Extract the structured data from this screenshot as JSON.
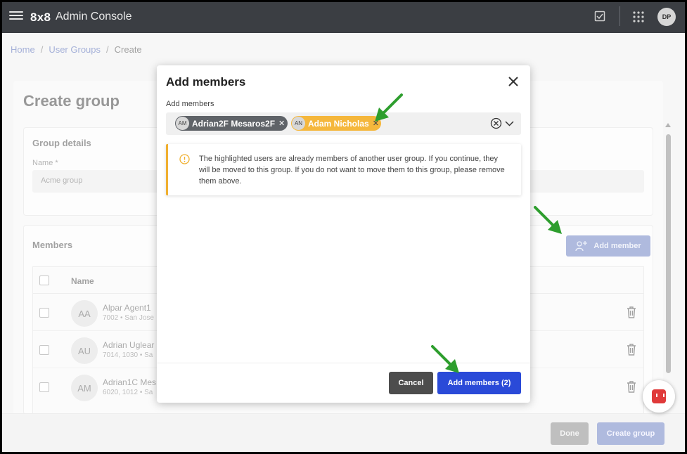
{
  "topbar": {
    "logo": "8x8",
    "title": "Admin Console",
    "user_initials": "DP",
    "icons": [
      "hamburger-menu-icon",
      "checklist-icon",
      "app-grid-icon"
    ]
  },
  "breadcrumb": {
    "home": "Home",
    "user_groups": "User Groups",
    "current": "Create",
    "separator": "/"
  },
  "page": {
    "title": "Create group",
    "details": {
      "title": "Group details",
      "name_label": "Name *",
      "name_value": "Acme group"
    },
    "members": {
      "title": "Members",
      "add_member_label": "Add member",
      "column_name": "Name",
      "rows": [
        {
          "initials": "AA",
          "name": "Alpar Agent1",
          "sub": "7002 • San Jose"
        },
        {
          "initials": "AU",
          "name": "Adrian Uglear",
          "sub": "7014, 1030 • Sa"
        },
        {
          "initials": "AM",
          "name": "Adrian1C Mes",
          "sub": "6020, 1012 • Sa"
        }
      ]
    },
    "footer": {
      "done_label": "Done",
      "create_label": "Create group"
    }
  },
  "modal": {
    "title": "Add members",
    "field_label": "Add members",
    "chips": [
      {
        "initials": "AM",
        "name": "Adrian2F Mesaros2F",
        "highlighted": false
      },
      {
        "initials": "AN",
        "name": "Adam Nicholas",
        "highlighted": true
      }
    ],
    "warning": "The highlighted users are already members of another user group. If you continue, they will be moved to this group. If you do not want to move them to this group, please remove them above.",
    "cancel_label": "Cancel",
    "add_label": "Add members (2)"
  },
  "colors": {
    "topbar": "#3b3e43",
    "primary": "#2a4ad8",
    "highlight_chip": "#f5b73c",
    "annotation_arrow": "#2e9e2e"
  }
}
